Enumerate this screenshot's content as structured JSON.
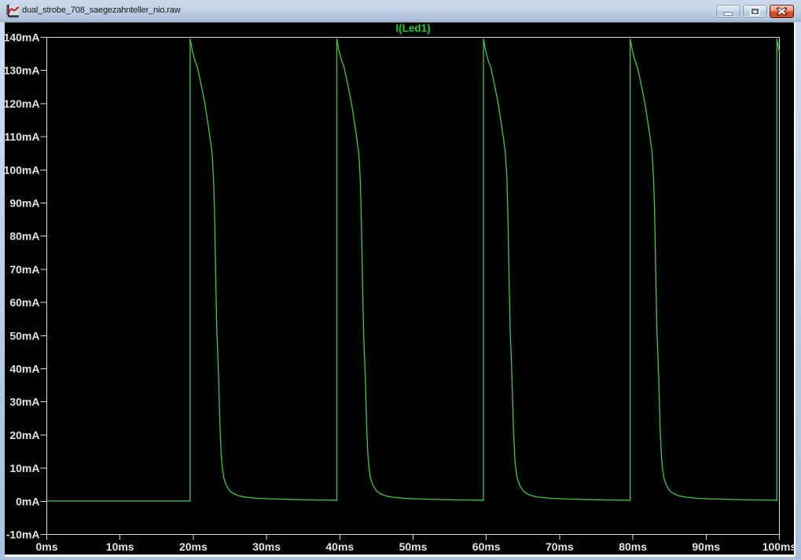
{
  "window": {
    "title": "dual_strobe_708_saegezahnteller_nio.raw",
    "icon": "waveform-document-icon",
    "caption_buttons": {
      "minimize": "minimize",
      "restore": "restore-down",
      "close": "close"
    }
  },
  "chart_data": {
    "type": "line",
    "title": "I(Led1)",
    "legend_position": "top-center",
    "grid": false,
    "background": "#000000",
    "frame_color": "#dadada",
    "trace_color": "#3ecb3e",
    "legend_color": "#1bd41b",
    "tick_label_color": "#e3e3e3",
    "xlabel": "",
    "ylabel": "",
    "x_unit": "ms",
    "y_unit": "mA",
    "xlim_ms": [
      0,
      100
    ],
    "ylim_ma": [
      -10,
      140
    ],
    "x_tick_step_ms": 10,
    "y_tick_step_ma": 10,
    "x_tick_labels": [
      "0ms",
      "10ms",
      "20ms",
      "30ms",
      "40ms",
      "50ms",
      "60ms",
      "70ms",
      "80ms",
      "90ms",
      "100ms"
    ],
    "y_tick_labels": [
      "140mA",
      "130mA",
      "120mA",
      "110mA",
      "100mA",
      "90mA",
      "80mA",
      "70mA",
      "60mA",
      "50mA",
      "40mA",
      "30mA",
      "20mA",
      "10mA",
      "0mA",
      "-10mA"
    ],
    "series": [
      {
        "name": "I(Led1)",
        "description": "Periodic LED current pulses: fast rise to ~139.5mA then nonlinear decay to ~0mA, period 20ms",
        "baseline_ma": 0.1,
        "pulse_peak_ma": 139.5,
        "pulse_period_ms": 20.02,
        "pulse_start_times_ms": [
          19.57,
          39.59,
          59.61,
          79.64,
          99.66
        ],
        "pulse_decay_dt_ms_vs_ma": [
          [
            0,
            139.5
          ],
          [
            0.25,
            136.5
          ],
          [
            0.6,
            133.3
          ],
          [
            1.0,
            130.9
          ],
          [
            1.5,
            125.7
          ],
          [
            2.0,
            120.2
          ],
          [
            2.35,
            115.2
          ],
          [
            2.7,
            109.9
          ],
          [
            3.0,
            105.0
          ],
          [
            3.2,
            97.0
          ],
          [
            3.35,
            85.0
          ],
          [
            3.5,
            67.0
          ],
          [
            3.65,
            51.0
          ],
          [
            3.8,
            43.0
          ],
          [
            3.9,
            36.5
          ],
          [
            4.0,
            28.5
          ],
          [
            4.1,
            21.0
          ],
          [
            4.25,
            14.0
          ],
          [
            4.4,
            10.0
          ],
          [
            4.6,
            7.1
          ],
          [
            4.9,
            5.0
          ],
          [
            5.4,
            3.2
          ],
          [
            6.0,
            2.2
          ],
          [
            6.75,
            1.6
          ],
          [
            7.6,
            1.25
          ],
          [
            9.1,
            0.93
          ],
          [
            11.2,
            0.73
          ],
          [
            13.5,
            0.58
          ],
          [
            16.0,
            0.46
          ],
          [
            18.0,
            0.39
          ],
          [
            20.1,
            0.32
          ]
        ]
      }
    ]
  }
}
